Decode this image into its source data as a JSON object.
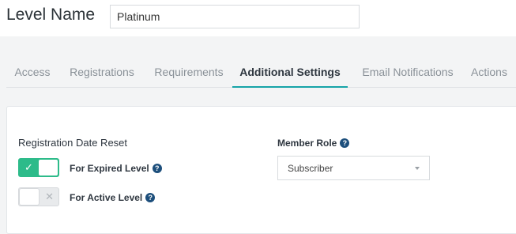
{
  "header": {
    "level_label": "Level Name",
    "level_value": "Platinum"
  },
  "tabs": [
    {
      "label": "Access",
      "active": false
    },
    {
      "label": "Registrations",
      "active": false
    },
    {
      "label": "Requirements",
      "active": false
    },
    {
      "label": "Additional Settings",
      "active": true
    },
    {
      "label": "Email Notifications",
      "active": false
    },
    {
      "label": "Actions",
      "active": false
    }
  ],
  "registration_reset": {
    "title": "Registration Date Reset",
    "expired": {
      "label": "For Expired Level",
      "on": true
    },
    "active": {
      "label": "For Active Level",
      "on": false
    }
  },
  "member_role": {
    "label": "Member Role",
    "value": "Subscriber"
  },
  "colors": {
    "accent_tab": "#17a4a8",
    "toggle_on": "#2dbb8a",
    "help_icon": "#1d4f7c"
  }
}
